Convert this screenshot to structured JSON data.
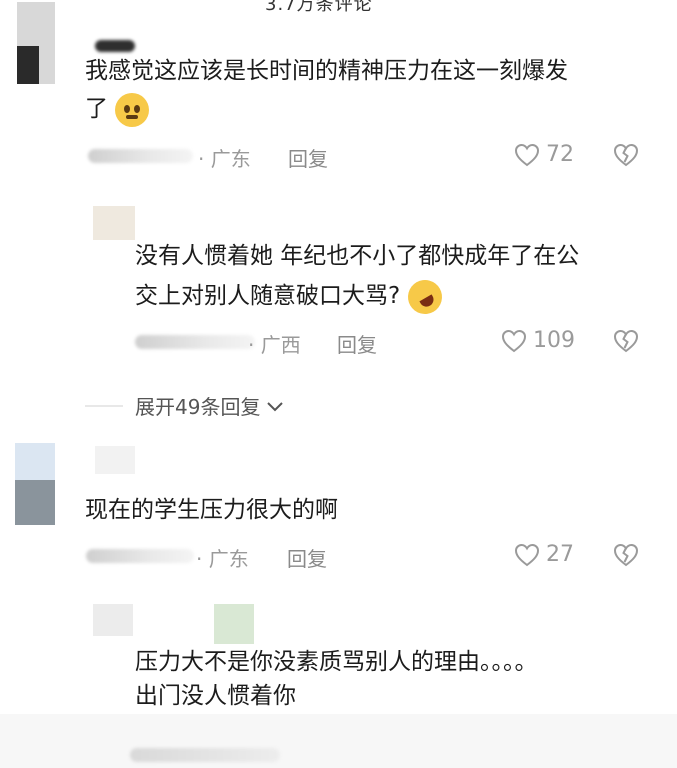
{
  "header": {
    "partial_title": "3.7万条评论"
  },
  "comments": [
    {
      "text_line1": "我感觉这应该是长时间的精神压力在这一刻爆发",
      "text_line2": "了",
      "location": "· 广东",
      "reply_label": "回复",
      "likes": "72",
      "emoji": "pleading-face-emoji"
    },
    {
      "text_line1": "没有人惯着她 年纪也不小了都快成年了在公",
      "text_line2": "交上对别人随意破口大骂?",
      "location": "· 广西",
      "reply_label": "回复",
      "likes": "109",
      "emoji": "rolling-laughing-emoji"
    },
    {
      "text_line1": "现在的学生压力很大的啊",
      "location": "· 广东",
      "reply_label": "回复",
      "likes": "27"
    },
    {
      "text_line1": "压力大不是你没素质骂别人的理由。。。。",
      "text_line2": "出门没人惯着你"
    }
  ],
  "expand_replies": {
    "label": "展开49条回复",
    "icon": "chevron-down-icon"
  },
  "icons": {
    "like": "heart-outline-icon",
    "dislike": "broken-heart-icon"
  },
  "colors": {
    "meta_gray": "#9a9a9a",
    "text": "#1c1c1c"
  }
}
